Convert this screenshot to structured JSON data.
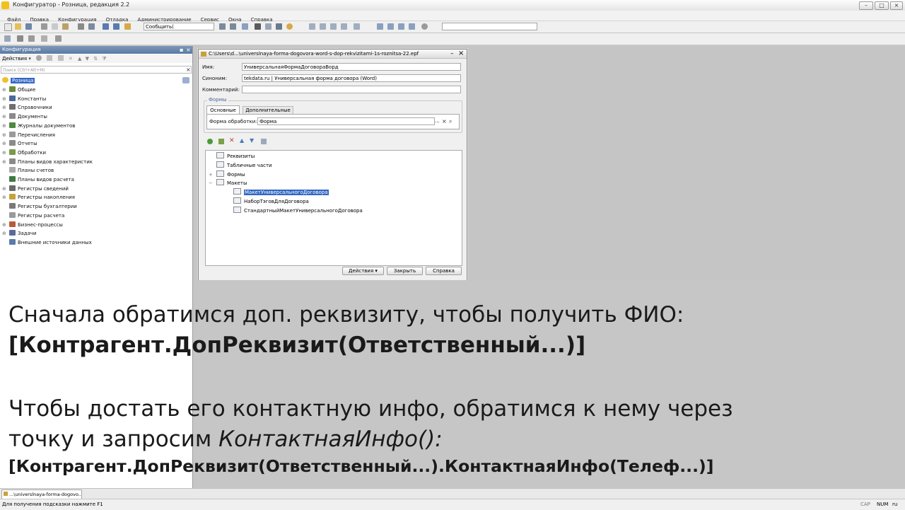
{
  "window": {
    "title": "Конфигуратор - Розница, редакция 2.2"
  },
  "menu": [
    "Файл",
    "Правка",
    "Конфигурация",
    "Отладка",
    "Администрирование",
    "Сервис",
    "Окна",
    "Справка"
  ],
  "toolbar": {
    "search_value": "Сообщить("
  },
  "config_panel": {
    "title": "Конфигурация",
    "actions_label": "Действия",
    "search_placeholder": "Поиск (Ctrl+Alt+M)",
    "root": "Розница",
    "items": [
      {
        "label": "Общие",
        "expandable": true,
        "color": "#6a8a3a"
      },
      {
        "label": "Константы",
        "expandable": true,
        "color": "#4a6a9a"
      },
      {
        "label": "Справочники",
        "expandable": true,
        "color": "#6f6f6f"
      },
      {
        "label": "Документы",
        "expandable": true,
        "color": "#8a8a8a"
      },
      {
        "label": "Журналы документов",
        "expandable": true,
        "color": "#4f8a3f"
      },
      {
        "label": "Перечисления",
        "expandable": true,
        "color": "#9a9a9a"
      },
      {
        "label": "Отчеты",
        "expandable": true,
        "color": "#8a8a8a"
      },
      {
        "label": "Обработки",
        "expandable": true,
        "color": "#7a9a4a"
      },
      {
        "label": "Планы видов характеристик",
        "expandable": true,
        "color": "#8a8a8a"
      },
      {
        "label": "Планы счетов",
        "expandable": false,
        "color": "#aaaaaa"
      },
      {
        "label": "Планы видов расчета",
        "expandable": false,
        "color": "#3f7a3f"
      },
      {
        "label": "Регистры сведений",
        "expandable": true,
        "color": "#6a6a6a"
      },
      {
        "label": "Регистры накопления",
        "expandable": true,
        "color": "#c5a23a"
      },
      {
        "label": "Регистры бухгалтерии",
        "expandable": false,
        "color": "#7a7a7a"
      },
      {
        "label": "Регистры расчета",
        "expandable": false,
        "color": "#9a9a9a"
      },
      {
        "label": "Бизнес-процессы",
        "expandable": true,
        "color": "#b85a3a"
      },
      {
        "label": "Задачи",
        "expandable": true,
        "color": "#5a6a9a"
      },
      {
        "label": "Внешние источники данных",
        "expandable": false,
        "color": "#5a7aaa"
      }
    ]
  },
  "dialog": {
    "title": "C:\\Users\\d...\\universlnaya-forma-dogovora-word-s-dop-rekvizitami-1s-roznitsa-22.epf",
    "name_label": "Имя:",
    "name_value": "УниверсальнаяФормаДоговораВорд",
    "synonym_label": "Синоним:",
    "synonym_value": "tekdata.ru | Универсальная форма договора (Word)",
    "comment_label": "Комментарий:",
    "comment_value": "",
    "forms_group": "Формы",
    "tabs": [
      "Основные",
      "Дополнительные"
    ],
    "form_label": "Форма обработки:",
    "form_value": "Форма",
    "tree": [
      {
        "label": "Реквизиты",
        "level": 1,
        "exp": ""
      },
      {
        "label": "Табличные части",
        "level": 1,
        "exp": ""
      },
      {
        "label": "Формы",
        "level": 1,
        "exp": "+"
      },
      {
        "label": "Макеты",
        "level": 1,
        "exp": "−"
      },
      {
        "label": "МакетУниверсальногоДоговора",
        "level": 2,
        "exp": "",
        "selected": true
      },
      {
        "label": "НаборТэговДляДоговора",
        "level": 2,
        "exp": ""
      },
      {
        "label": "СтандартныйМакетУниверсальногоДоговора",
        "level": 2,
        "exp": ""
      }
    ],
    "buttons": {
      "actions": "Действия",
      "close": "Закрыть",
      "help": "Справка"
    }
  },
  "caption": {
    "line1": "Сначала обратимся доп. реквизиту, чтобы получить ФИО:",
    "line2": "[Контрагент.ДопРеквизит(Ответственный...)]",
    "line3": "Чтобы достать его контактную инфо, обратимся к нему через",
    "line4a": "точку и запросим ",
    "line4b": "КонтактнаяИнфо():",
    "line5": "[Контрагент.ДопРеквизит(Ответственный...).КонтактнаяИнфо(Телеф...)]"
  },
  "taskbar": {
    "tab": "...\\universlnaya-forma-dogovo..."
  },
  "status": {
    "hint": "Для получения подсказки нажмите F1",
    "cap": "CAP",
    "num": "NUM",
    "lang": "ru"
  }
}
